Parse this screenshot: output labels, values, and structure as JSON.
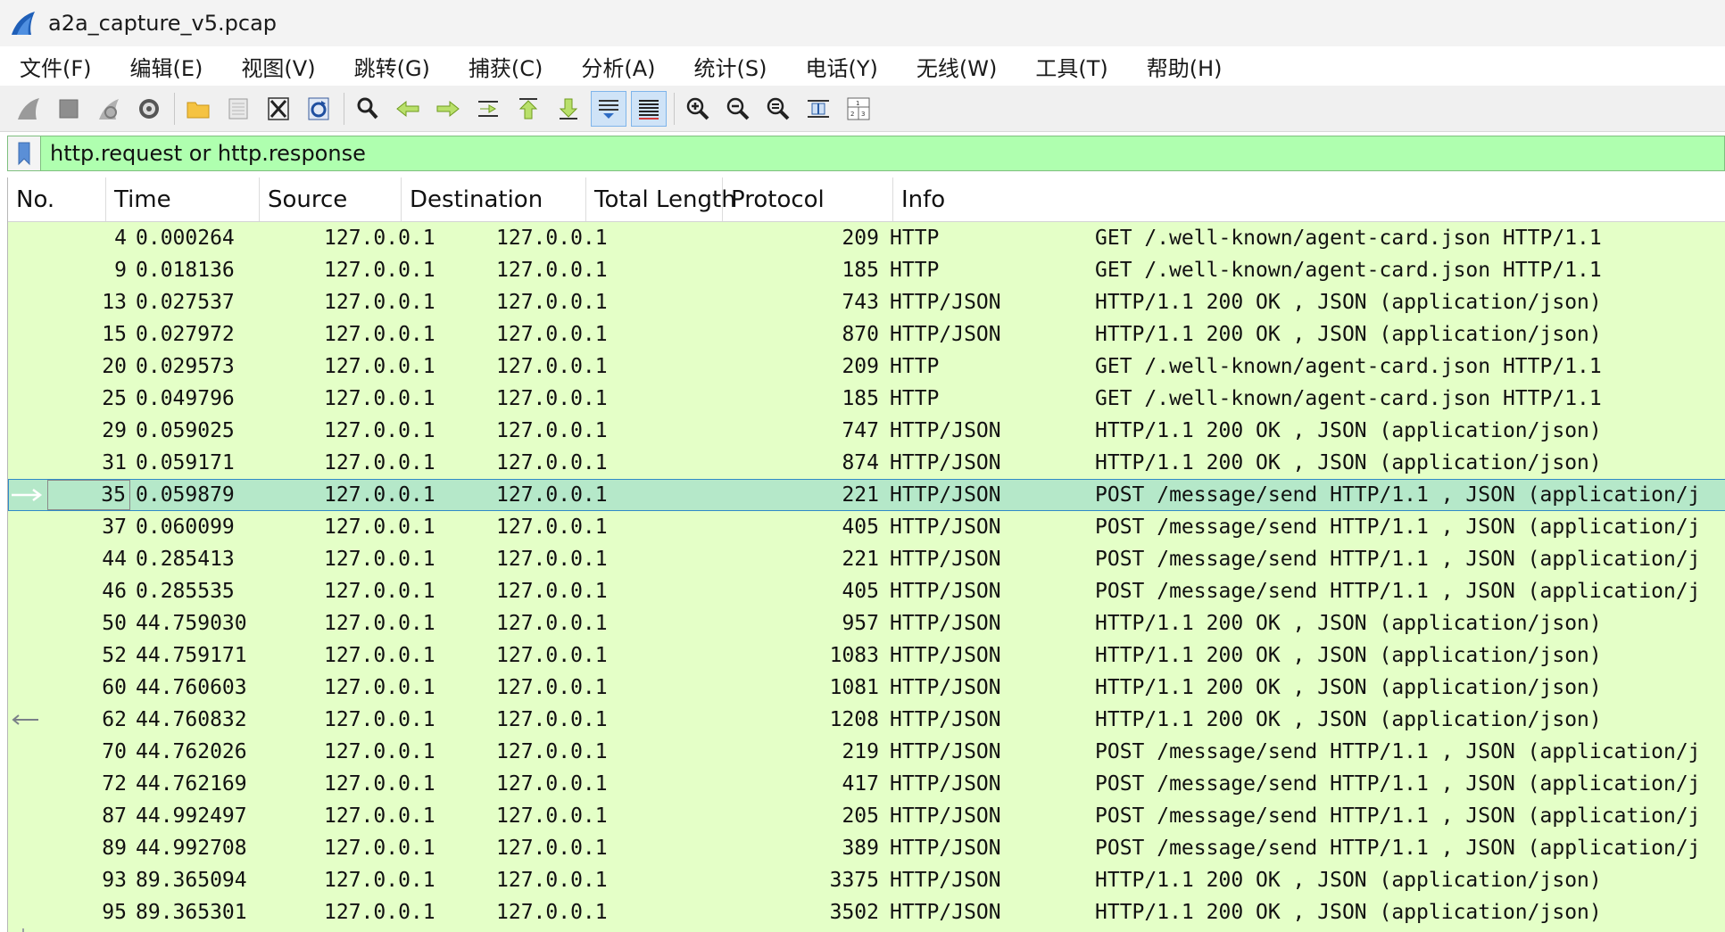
{
  "window": {
    "title": "a2a_capture_v5.pcap"
  },
  "menu": [
    "文件(F)",
    "编辑(E)",
    "视图(V)",
    "跳转(G)",
    "捕获(C)",
    "分析(A)",
    "统计(S)",
    "电话(Y)",
    "无线(W)",
    "工具(T)",
    "帮助(H)"
  ],
  "toolbar": {
    "icons": [
      "shark-fin-start-icon",
      "stop-icon",
      "restart-icon",
      "capture-options-icon",
      "open-folder-icon",
      "save-file-icon",
      "close-file-icon",
      "reload-file-icon",
      "find-packet-icon",
      "go-back-icon",
      "go-forward-icon",
      "go-to-packet-icon",
      "go-first-icon",
      "go-last-icon",
      "auto-scroll-icon",
      "colorize-icon",
      "zoom-in-icon",
      "zoom-out-icon",
      "zoom-reset-icon",
      "resize-columns-icon",
      "layout-panes-icon"
    ]
  },
  "filter": {
    "value": "http.request or http.response",
    "color": "#afffaf"
  },
  "columns": {
    "no": "No.",
    "time": "Time",
    "source": "Source",
    "destination": "Destination",
    "total_length": "Total Length",
    "protocol": "Protocol",
    "info": "Info"
  },
  "packets": [
    {
      "no": "4",
      "time": "0.000264",
      "src": "127.0.0.1",
      "dst": "127.0.0.1",
      "len": "209",
      "proto": "HTTP",
      "info": "GET /.well-known/agent-card.json HTTP/1.1"
    },
    {
      "no": "9",
      "time": "0.018136",
      "src": "127.0.0.1",
      "dst": "127.0.0.1",
      "len": "185",
      "proto": "HTTP",
      "info": "GET /.well-known/agent-card.json HTTP/1.1"
    },
    {
      "no": "13",
      "time": "0.027537",
      "src": "127.0.0.1",
      "dst": "127.0.0.1",
      "len": "743",
      "proto": "HTTP/JSON",
      "info": "HTTP/1.1 200 OK , JSON (application/json)"
    },
    {
      "no": "15",
      "time": "0.027972",
      "src": "127.0.0.1",
      "dst": "127.0.0.1",
      "len": "870",
      "proto": "HTTP/JSON",
      "info": "HTTP/1.1 200 OK , JSON (application/json)"
    },
    {
      "no": "20",
      "time": "0.029573",
      "src": "127.0.0.1",
      "dst": "127.0.0.1",
      "len": "209",
      "proto": "HTTP",
      "info": "GET /.well-known/agent-card.json HTTP/1.1"
    },
    {
      "no": "25",
      "time": "0.049796",
      "src": "127.0.0.1",
      "dst": "127.0.0.1",
      "len": "185",
      "proto": "HTTP",
      "info": "GET /.well-known/agent-card.json HTTP/1.1"
    },
    {
      "no": "29",
      "time": "0.059025",
      "src": "127.0.0.1",
      "dst": "127.0.0.1",
      "len": "747",
      "proto": "HTTP/JSON",
      "info": "HTTP/1.1 200 OK , JSON (application/json)"
    },
    {
      "no": "31",
      "time": "0.059171",
      "src": "127.0.0.1",
      "dst": "127.0.0.1",
      "len": "874",
      "proto": "HTTP/JSON",
      "info": "HTTP/1.1 200 OK , JSON (application/json)"
    },
    {
      "no": "35",
      "time": "0.059879",
      "src": "127.0.0.1",
      "dst": "127.0.0.1",
      "len": "221",
      "proto": "HTTP/JSON",
      "info": "POST /message/send HTTP/1.1 , JSON (application/j",
      "selected": true
    },
    {
      "no": "37",
      "time": "0.060099",
      "src": "127.0.0.1",
      "dst": "127.0.0.1",
      "len": "405",
      "proto": "HTTP/JSON",
      "info": "POST /message/send HTTP/1.1 , JSON (application/j"
    },
    {
      "no": "44",
      "time": "0.285413",
      "src": "127.0.0.1",
      "dst": "127.0.0.1",
      "len": "221",
      "proto": "HTTP/JSON",
      "info": "POST /message/send HTTP/1.1 , JSON (application/j"
    },
    {
      "no": "46",
      "time": "0.285535",
      "src": "127.0.0.1",
      "dst": "127.0.0.1",
      "len": "405",
      "proto": "HTTP/JSON",
      "info": "POST /message/send HTTP/1.1 , JSON (application/j"
    },
    {
      "no": "50",
      "time": "44.759030",
      "src": "127.0.0.1",
      "dst": "127.0.0.1",
      "len": "957",
      "proto": "HTTP/JSON",
      "info": "HTTP/1.1 200 OK , JSON (application/json)"
    },
    {
      "no": "52",
      "time": "44.759171",
      "src": "127.0.0.1",
      "dst": "127.0.0.1",
      "len": "1083",
      "proto": "HTTP/JSON",
      "info": "HTTP/1.1 200 OK , JSON (application/json)"
    },
    {
      "no": "60",
      "time": "44.760603",
      "src": "127.0.0.1",
      "dst": "127.0.0.1",
      "len": "1081",
      "proto": "HTTP/JSON",
      "info": "HTTP/1.1 200 OK , JSON (application/json)"
    },
    {
      "no": "62",
      "time": "44.760832",
      "src": "127.0.0.1",
      "dst": "127.0.0.1",
      "len": "1208",
      "proto": "HTTP/JSON",
      "info": "HTTP/1.1 200 OK , JSON (application/json)",
      "response_marker": true
    },
    {
      "no": "70",
      "time": "44.762026",
      "src": "127.0.0.1",
      "dst": "127.0.0.1",
      "len": "219",
      "proto": "HTTP/JSON",
      "info": "POST /message/send HTTP/1.1 , JSON (application/j"
    },
    {
      "no": "72",
      "time": "44.762169",
      "src": "127.0.0.1",
      "dst": "127.0.0.1",
      "len": "417",
      "proto": "HTTP/JSON",
      "info": "POST /message/send HTTP/1.1 , JSON (application/j"
    },
    {
      "no": "87",
      "time": "44.992497",
      "src": "127.0.0.1",
      "dst": "127.0.0.1",
      "len": "205",
      "proto": "HTTP/JSON",
      "info": "POST /message/send HTTP/1.1 , JSON (application/j"
    },
    {
      "no": "89",
      "time": "44.992708",
      "src": "127.0.0.1",
      "dst": "127.0.0.1",
      "len": "389",
      "proto": "HTTP/JSON",
      "info": "POST /message/send HTTP/1.1 , JSON (application/j"
    },
    {
      "no": "93",
      "time": "89.365094",
      "src": "127.0.0.1",
      "dst": "127.0.0.1",
      "len": "3375",
      "proto": "HTTP/JSON",
      "info": "HTTP/1.1 200 OK , JSON (application/json)"
    },
    {
      "no": "95",
      "time": "89.365301",
      "src": "127.0.0.1",
      "dst": "127.0.0.1",
      "len": "3502",
      "proto": "HTTP/JSON",
      "info": "HTTP/1.1 200 OK , JSON (application/json)"
    }
  ]
}
